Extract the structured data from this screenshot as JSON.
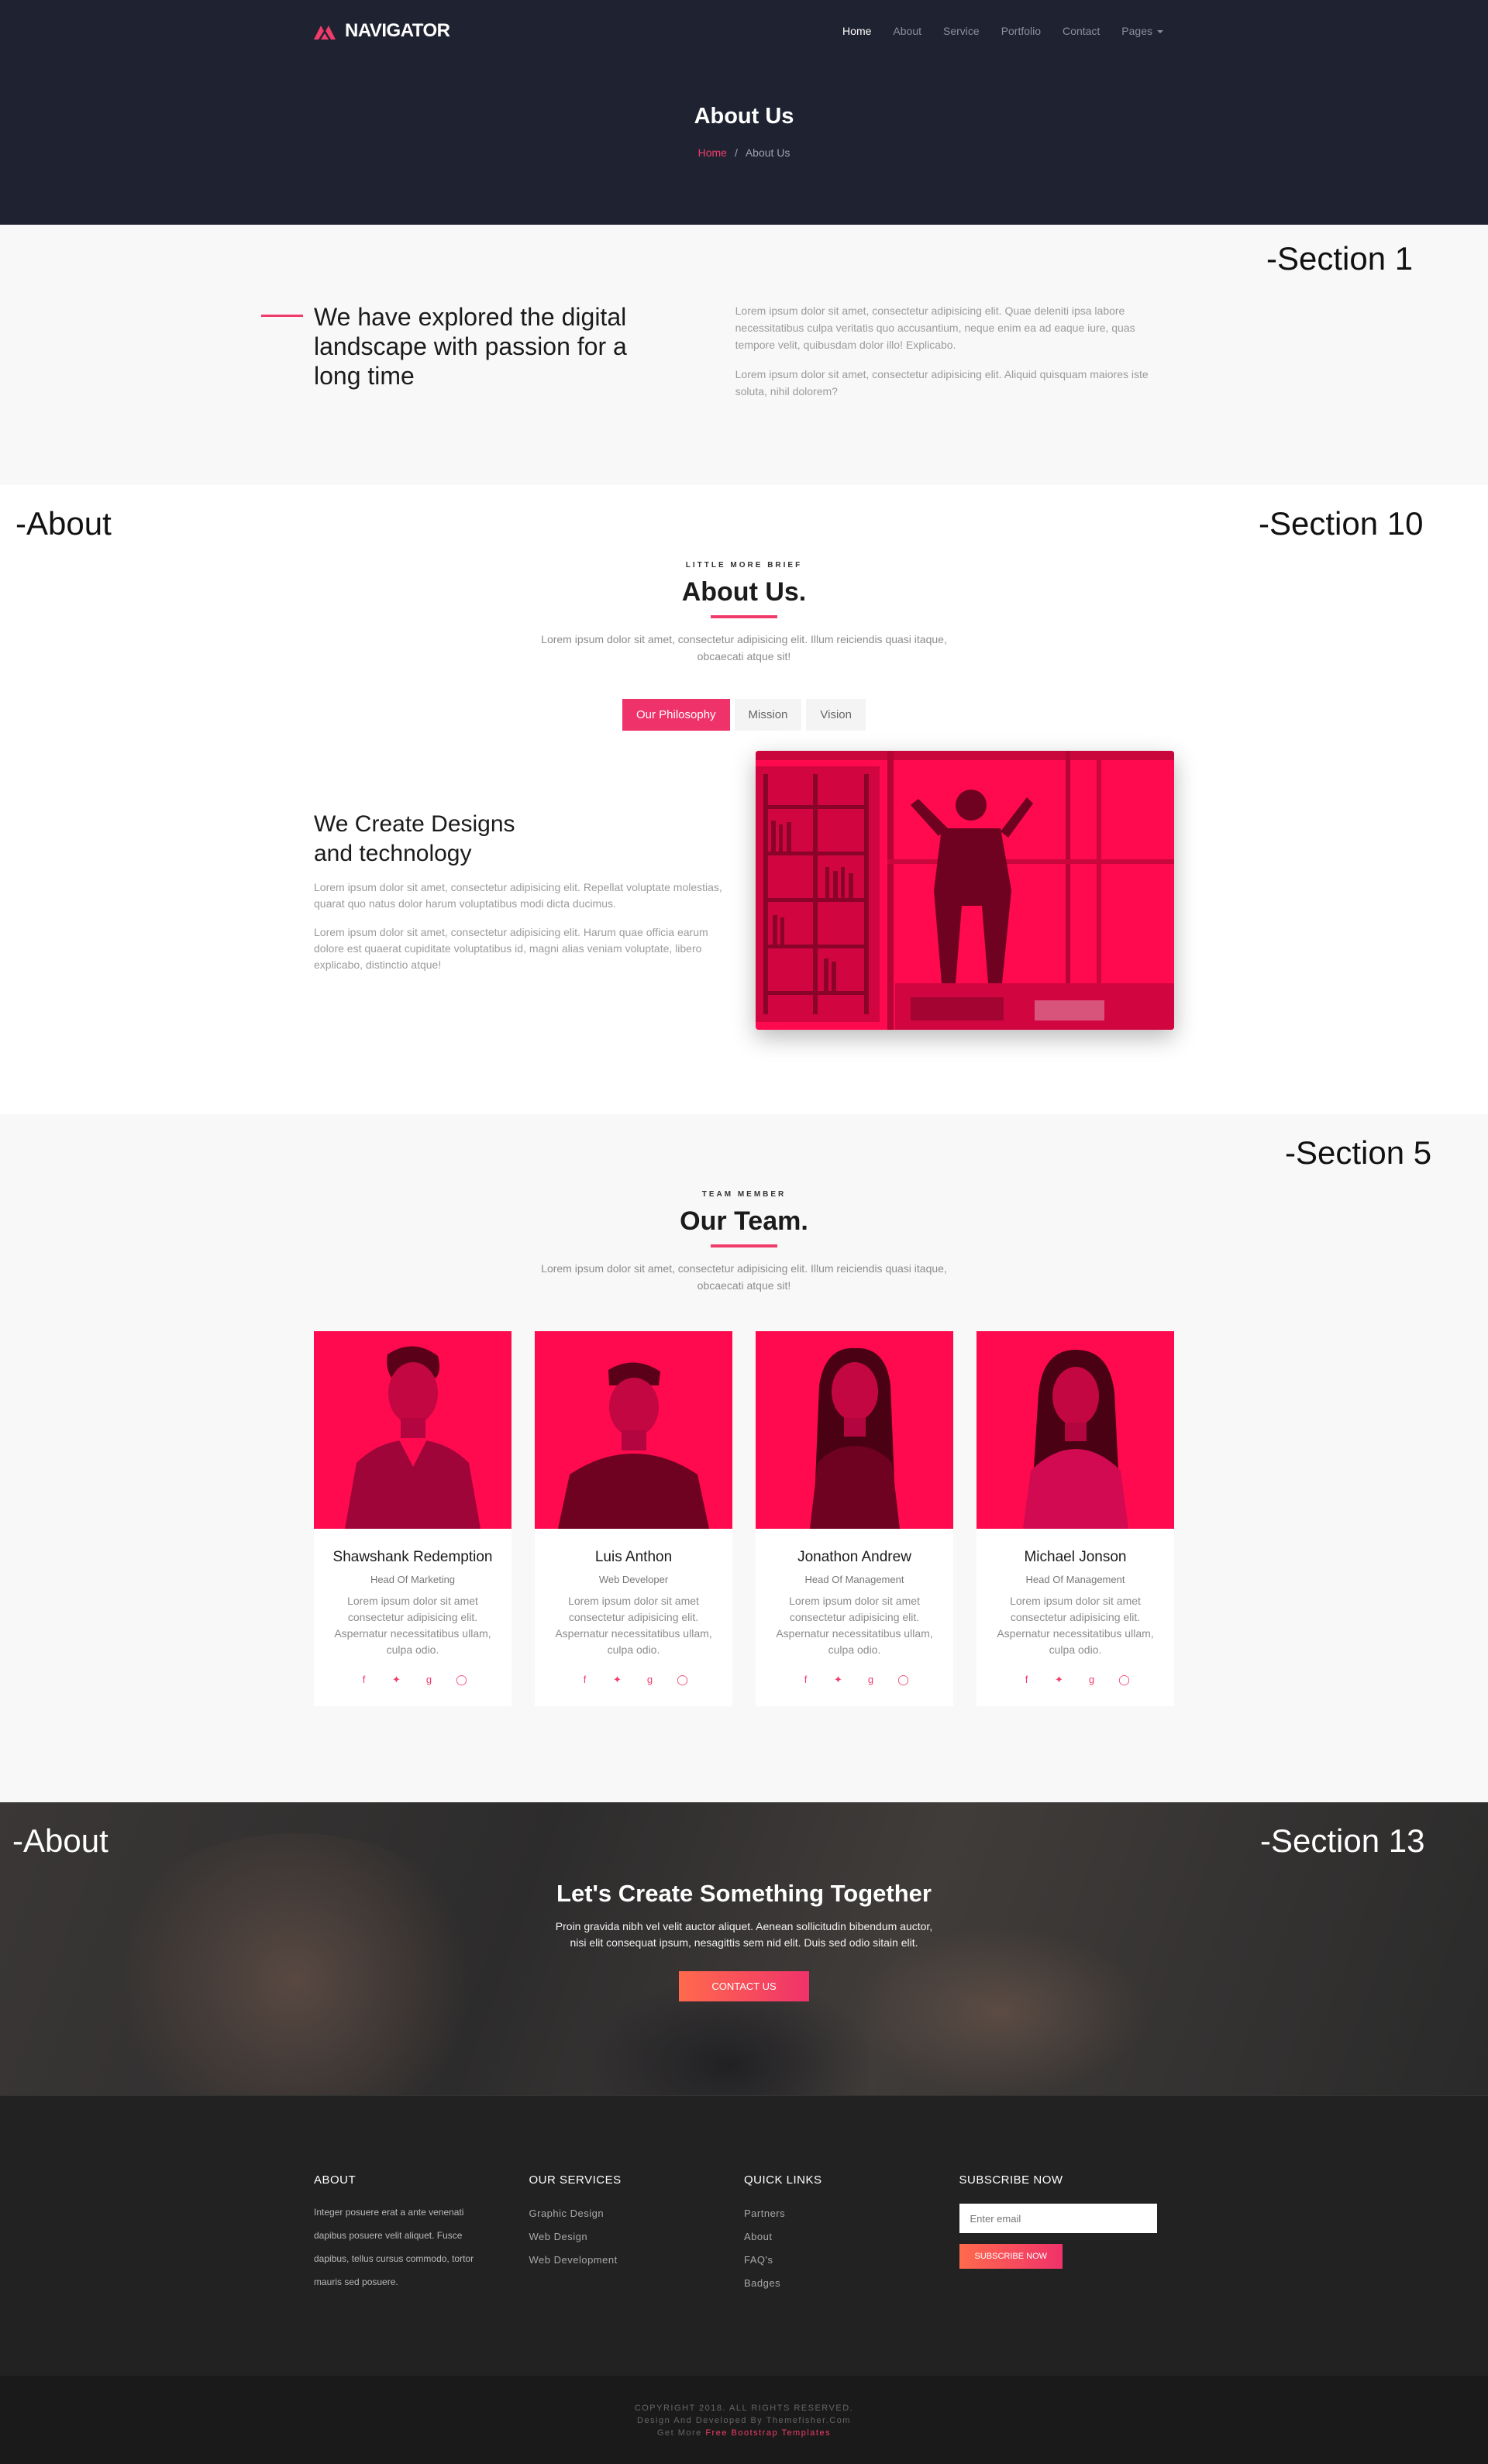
{
  "header": {
    "logo": "NAVIGATOR",
    "nav": [
      "Home",
      "About",
      "Service",
      "Portfolio",
      "Contact",
      "Pages"
    ],
    "title": "About Us",
    "breadcrumb": {
      "home": "Home",
      "sep": "/",
      "current": "About Us"
    }
  },
  "annotations": {
    "section1": "-Section 1",
    "about1": "-About",
    "section10": "-Section 10",
    "section5": "-Section 5",
    "about2": "-About",
    "section13": "-Section 13"
  },
  "section1": {
    "heading": "We have explored the digital landscape with passion for a long time",
    "p1": "Lorem ipsum dolor sit amet, consectetur adipisicing elit. Quae deleniti ipsa labore necessitatibus culpa veritatis quo accusantium, neque enim ea ad eaque iure, quas tempore velit, quibusdam dolor illo! Explicabo.",
    "p2": "Lorem ipsum dolor sit amet, consectetur adipisicing elit. Aliquid quisquam maiores iste soluta, nihil dolorem?"
  },
  "about": {
    "kicker": "LITTLE MORE BRIEF",
    "title": "About Us.",
    "lead": "Lorem ipsum dolor sit amet, consectetur adipisicing elit. Illum reiciendis quasi itaque, obcaecati atque sit!",
    "tabs": [
      "Our Philosophy",
      "Mission",
      "Vision"
    ],
    "active_tab": "Our Philosophy",
    "heading_line1": "We Create Designs",
    "heading_line2": "and technology",
    "p1": "Lorem ipsum dolor sit amet, consectetur adipisicing elit. Repellat voluptate molestias, quarat quo natus dolor harum voluptatibus modi dicta ducimus.",
    "p2": "Lorem ipsum dolor sit amet, consectetur adipisicing elit. Harum quae officia earum dolore est quaerat cupiditate voluptatibus id, magni alias veniam voluptate, libero explicabo, distinctio atque!"
  },
  "team": {
    "kicker": "TEAM MEMBER",
    "title": "Our Team.",
    "lead": "Lorem ipsum dolor sit amet, consectetur adipisicing elit. Illum reiciendis quasi itaque, obcaecati atque sit!",
    "members": [
      {
        "name": "Shawshank Redemption",
        "role": "Head Of Marketing",
        "desc": "Lorem ipsum dolor sit amet consectetur adipisicing elit. Aspernatur necessitatibus ullam, culpa odio."
      },
      {
        "name": "Luis Anthon",
        "role": "Web Developer",
        "desc": "Lorem ipsum dolor sit amet consectetur adipisicing elit. Aspernatur necessitatibus ullam, culpa odio."
      },
      {
        "name": "Jonathon Andrew",
        "role": "Head Of Management",
        "desc": "Lorem ipsum dolor sit amet consectetur adipisicing elit. Aspernatur necessitatibus ullam, culpa odio."
      },
      {
        "name": "Michael Jonson",
        "role": "Head Of Management",
        "desc": "Lorem ipsum dolor sit amet consectetur adipisicing elit. Aspernatur necessitatibus ullam, culpa odio."
      }
    ],
    "social_icons": [
      "f",
      "twitter-icon",
      "g",
      "pinterest-icon"
    ]
  },
  "cta": {
    "title": "Let's Create Something Together",
    "text": "Proin gravida nibh vel velit auctor aliquet. Aenean sollicitudin bibendum auctor, nisi elit consequat ipsum, nesagittis sem nid elit. Duis sed odio sitain elit.",
    "button": "CONTACT US"
  },
  "footer": {
    "about_title": "ABOUT",
    "about_text": "Integer posuere erat a ante venenati dapibus posuere velit aliquet. Fusce dapibus, tellus cursus commodo, tortor mauris sed posuere.",
    "services_title": "OUR SERVICES",
    "services": [
      "Graphic Design",
      "Web Design",
      "Web Development"
    ],
    "links_title": "QUICK LINKS",
    "links": [
      "Partners",
      "About",
      "FAQ's",
      "Badges"
    ],
    "subscribe_title": "SUBSCRIBE NOW",
    "email_placeholder": "Enter email",
    "subscribe_button": "SUBSCRIBE NOW",
    "copyright": "COPYRIGHT 2018. ALL RIGHTS RESERVED.",
    "credit": "Design And Developed By Themefisher.Com",
    "more_prefix": "Get More",
    "more_link": "Free Bootstrap Templates"
  },
  "colors": {
    "accent": "#f03c6b",
    "hero_bg": "#1f2331",
    "footer_bg": "#222222",
    "photo_tint": "#ff0a4e"
  }
}
